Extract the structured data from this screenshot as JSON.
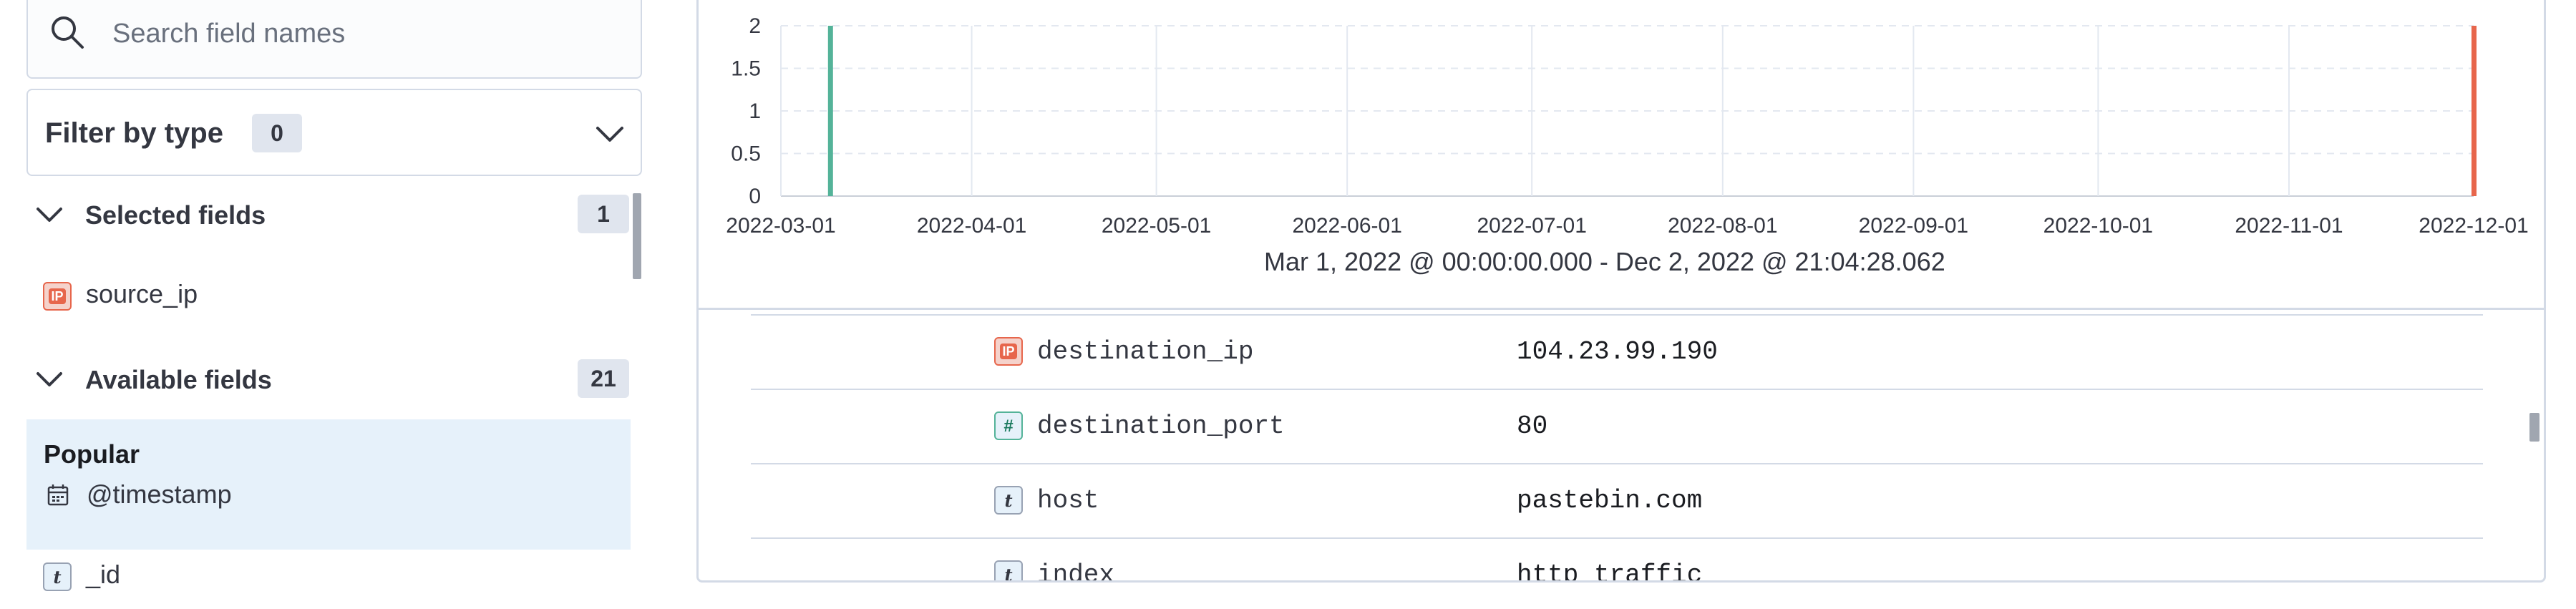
{
  "sidebar": {
    "search_placeholder": "Search field names",
    "filter_label": "Filter by type",
    "filter_count": "0",
    "selected": {
      "title": "Selected fields",
      "count": "1",
      "items": [
        {
          "type": "ip",
          "name": "source_ip"
        }
      ]
    },
    "available": {
      "title": "Available fields",
      "count": "21",
      "popular_title": "Popular",
      "popular_items": [
        {
          "type": "date",
          "name": "@timestamp"
        }
      ],
      "items": [
        {
          "type": "string",
          "name": "_id"
        }
      ]
    }
  },
  "chart_data": {
    "type": "bar",
    "y_ticks": [
      "2",
      "1.5",
      "1",
      "0.5",
      "0"
    ],
    "ylim": [
      0,
      2
    ],
    "x_ticks": [
      "2022-03-01",
      "2022-04-01",
      "2022-05-01",
      "2022-06-01",
      "2022-07-01",
      "2022-08-01",
      "2022-09-01",
      "2022-10-01",
      "2022-11-01",
      "2022-12-01"
    ],
    "series": [
      {
        "x": "2022-03-09",
        "value": 2,
        "color": "#54b399"
      },
      {
        "x": "2022-12-01",
        "value": 2,
        "color": "#e7664c"
      }
    ],
    "grid": true,
    "time_range": "Mar 1, 2022 @ 00:00:00.000 - Dec 2, 2022 @ 21:04:28.062"
  },
  "document": {
    "rows": [
      {
        "type": "ip",
        "key": "destination_ip",
        "value": "104.23.99.190"
      },
      {
        "type": "number",
        "key": "destination_port",
        "value": "80"
      },
      {
        "type": "string",
        "key": "host",
        "value": "pastebin.com"
      },
      {
        "type": "string",
        "key": "index",
        "value": "http_traffic"
      }
    ]
  }
}
